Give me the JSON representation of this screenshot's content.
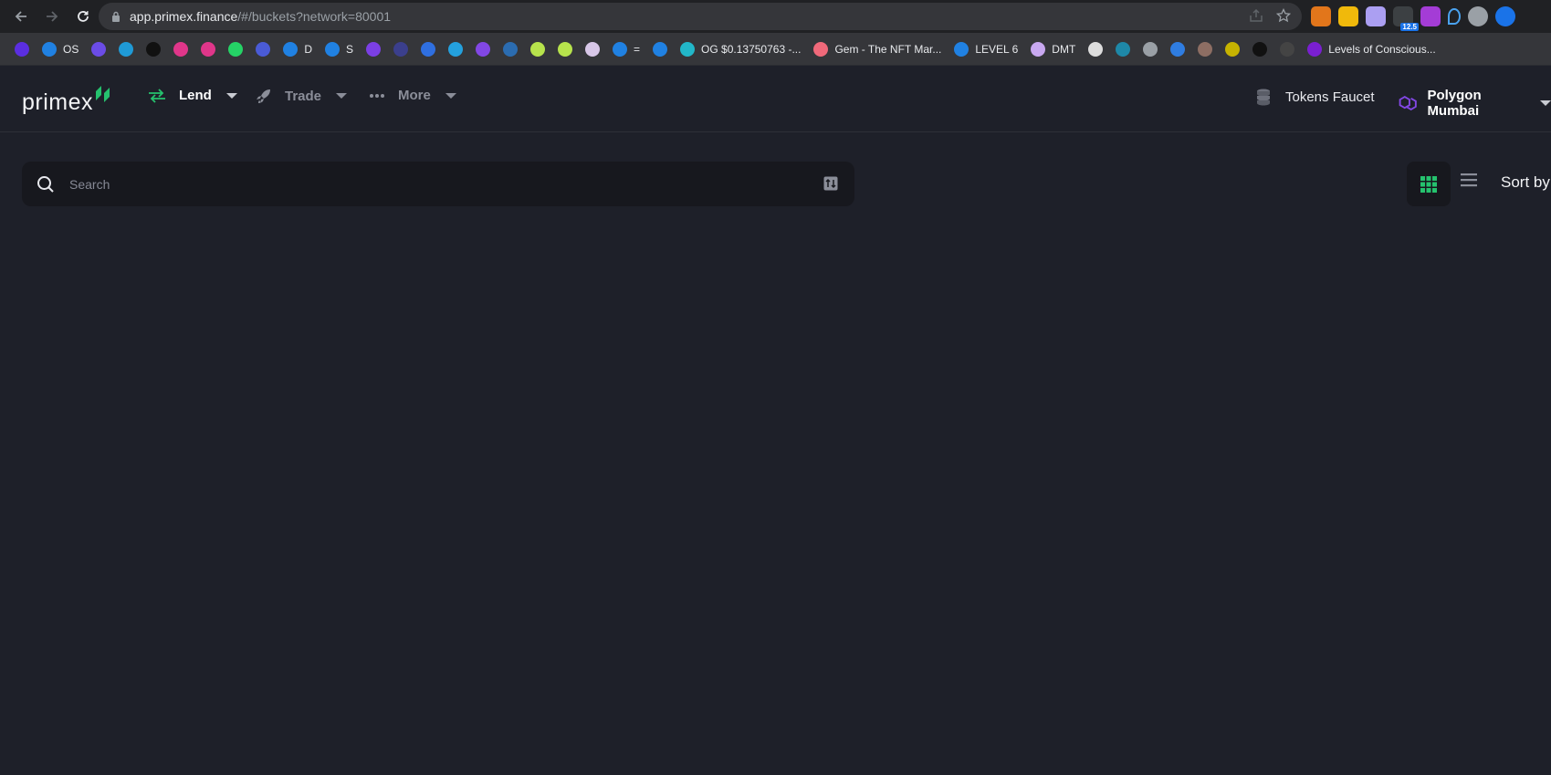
{
  "browser": {
    "url_host": "app.primex.finance",
    "url_path": "/#/buckets?network=80001",
    "extension_badge": "12.5",
    "bookmarks": [
      {
        "label": "",
        "color": "#5b2ee0"
      },
      {
        "label": "OS",
        "color": "#2081e2"
      },
      {
        "label": "",
        "color": "#6b4ce6"
      },
      {
        "label": "",
        "color": "#1f9ad6"
      },
      {
        "label": "",
        "color": "#111111"
      },
      {
        "label": "",
        "color": "#e0368a"
      },
      {
        "label": "",
        "color": "#e0368a"
      },
      {
        "label": "",
        "color": "#25d366"
      },
      {
        "label": "",
        "color": "#4a5bd6"
      },
      {
        "label": "D",
        "color": "#2081e2"
      },
      {
        "label": "S",
        "color": "#2081e2"
      },
      {
        "label": "",
        "color": "#7b3fe4"
      },
      {
        "label": "",
        "color": "#3b3f8c"
      },
      {
        "label": "",
        "color": "#2f6fe0"
      },
      {
        "label": "",
        "color": "#24a1de"
      },
      {
        "label": "",
        "color": "#8247e5"
      },
      {
        "label": "",
        "color": "#2b6cb0"
      },
      {
        "label": "",
        "color": "#b7e34c"
      },
      {
        "label": "",
        "color": "#b7e34c"
      },
      {
        "label": "",
        "color": "#d8c7e8"
      },
      {
        "label": "=",
        "color": "#2081e2"
      },
      {
        "label": "",
        "color": "#2081e2"
      },
      {
        "label": "OG $0.13750763 -...",
        "color": "#22b7c9"
      },
      {
        "label": "Gem - The NFT Mar...",
        "color": "#f0697a"
      },
      {
        "label": "LEVEL 6",
        "color": "#2081e2"
      },
      {
        "label": "DMT",
        "color": "#c8a8f0"
      },
      {
        "label": "",
        "color": "#dddddd"
      },
      {
        "label": "",
        "color": "#1e88a8"
      },
      {
        "label": "",
        "color": "#9aa0a6"
      },
      {
        "label": "",
        "color": "#2f7de1"
      },
      {
        "label": "",
        "color": "#8d6e63"
      },
      {
        "label": "",
        "color": "#c6b300"
      },
      {
        "label": "",
        "color": "#111111"
      },
      {
        "label": "",
        "color": "#444444"
      },
      {
        "label": "Levels of Conscious...",
        "color": "#7a1fd1"
      }
    ]
  },
  "header": {
    "logo_text": "primex",
    "nav": [
      {
        "label": "Lend",
        "active": true
      },
      {
        "label": "Trade",
        "active": false
      },
      {
        "label": "More",
        "active": false
      }
    ],
    "tokens_faucet": "Tokens Faucet",
    "network": "Polygon Mumbai"
  },
  "main": {
    "search_placeholder": "Search",
    "sort_label": "Sort by"
  },
  "colors": {
    "accent_green": "#25c26e",
    "polygon_purple": "#8247e5",
    "background": "#1e2029"
  }
}
